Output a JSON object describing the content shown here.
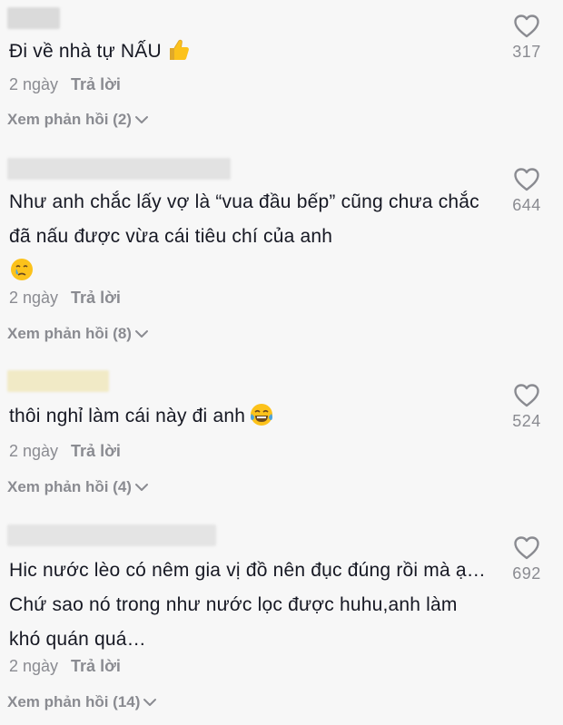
{
  "comments": [
    {
      "text": "Đi về nhà tự NẤU",
      "emoji": "thumbs-up",
      "age": "2 ngày",
      "reply_label": "Trả lời",
      "view_replies": "Xem phản hồi (2)",
      "likes": "317"
    },
    {
      "text": "Như anh chắc lấy vợ là “vua đầu bếp” cũng chưa chắc đã nấu được vừa cái tiêu chí của anh",
      "emoji": "crying-face",
      "age": "2 ngày",
      "reply_label": "Trả lời",
      "view_replies": "Xem phản hồi (8)",
      "likes": "644"
    },
    {
      "text": "thôi nghỉ làm cái này đi anh",
      "emoji": "tears-of-joy",
      "age": "2 ngày",
      "reply_label": "Trả lời",
      "view_replies": "Xem phản hồi (4)",
      "likes": "524"
    },
    {
      "text": "Hic nước lèo có nêm gia vị đồ nên đục đúng rồi mà ạ… Chứ sao nó trong như nước lọc được huhu,anh làm khó quán quá…",
      "emoji": "",
      "age": "2 ngày",
      "reply_label": "Trả lời",
      "view_replies": "Xem phản hồi (14)",
      "likes": "692"
    }
  ],
  "icons": {
    "like": "heart-outline-icon",
    "expand": "chevron-down-icon"
  },
  "colors": {
    "background": "#f7f7f7",
    "text": "#161823",
    "secondary": "#8a8b91"
  }
}
